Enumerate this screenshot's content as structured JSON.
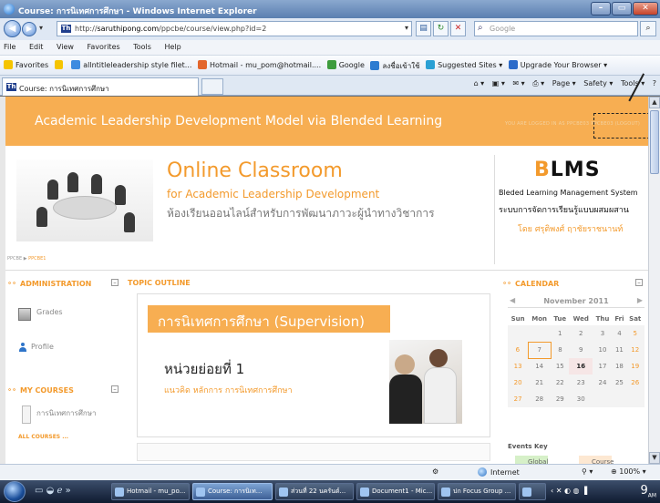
{
  "window": {
    "title": "Course: การนิเทศการศึกษา - Windows Internet Explorer"
  },
  "address_bar": {
    "url_prefix": "http://",
    "url_host": "saruthipong.com",
    "url_path": "/ppcbe/course/view.php?id=2",
    "search_placeholder": "Google"
  },
  "menu": [
    "File",
    "Edit",
    "View",
    "Favorites",
    "Tools",
    "Help"
  ],
  "favorites_bar": {
    "label": "Favorites",
    "items": [
      "allntitleleadership style filet...",
      "Hotmail - mu_pom@hotmail....",
      "Google",
      "ลงชื่อเข้าใช้",
      "Suggested Sites ▾",
      "Upgrade Your Browser ▾"
    ]
  },
  "tab": {
    "label": "Course: การนิเทศการศึกษา"
  },
  "command_bar": [
    "Page ▾",
    "Safety ▾",
    "Tools ▾"
  ],
  "page": {
    "banner_title": "Academic Leadership Development Model via Blended Learning",
    "login_text": "YOU ARE LOGGED IN AS PPCBE03 PPCBE03 (LOGOUT)",
    "header": {
      "title": "Online Classroom",
      "subtitle": "for Academic Leadership Development",
      "thai": "ห้องเรียนออนไลน์สำหรับการพัฒนาภาวะผู้นำทางวิชาการ",
      "brand": "BLMS",
      "brand_en": "Bleded Learning Management System",
      "brand_th": "ระบบการจัดการเรียนรู้แบบผสมผสาน",
      "author": "โดย ศรุติพงศ์  ฤาชัยราชนานท์",
      "breadcrumb_home": "PPCBE",
      "breadcrumb_current": "PPCBE1"
    },
    "left": {
      "admin_title": "ADMINISTRATION",
      "grades": "Grades",
      "profile": "Profile",
      "mycourses_title": "MY COURSES",
      "course_name": "การนิเทศการศึกษา",
      "all_courses": "ALL COURSES ..."
    },
    "center": {
      "topic_title": "TOPIC OUTLINE",
      "supervision": "การนิเทศการศึกษา (Supervision)",
      "unit": "หน่วยย่อยที่ 1",
      "unit_sub": "แนวคิด หลักการ การนิเทศการศึกษา"
    },
    "calendar": {
      "title": "CALENDAR",
      "month": "November 2011",
      "days": [
        "Sun",
        "Mon",
        "Tue",
        "Wed",
        "Thu",
        "Fri",
        "Sat"
      ],
      "weeks": [
        [
          "",
          "",
          "1",
          "2",
          "3",
          "4",
          "5"
        ],
        [
          "6",
          "7",
          "8",
          "9",
          "10",
          "11",
          "12"
        ],
        [
          "13",
          "14",
          "15",
          "16",
          "17",
          "18",
          "19"
        ],
        [
          "20",
          "21",
          "22",
          "23",
          "24",
          "25",
          "26"
        ],
        [
          "27",
          "28",
          "29",
          "30",
          "",
          "",
          ""
        ]
      ],
      "events_key": "Events Key",
      "key_global": "Global",
      "key_course": "Course"
    }
  },
  "status": {
    "zone": "Internet",
    "zoom": "100%"
  },
  "taskbar": {
    "tasks": [
      "Hotmail - mu_po...",
      "Course: การนิเท...",
      "ส่วนที่ 22 นครันต์...",
      "Document1 - Mic...",
      "ปก Focus Group ...",
      ""
    ],
    "clock": "9",
    "clock_suffix": "AM"
  }
}
